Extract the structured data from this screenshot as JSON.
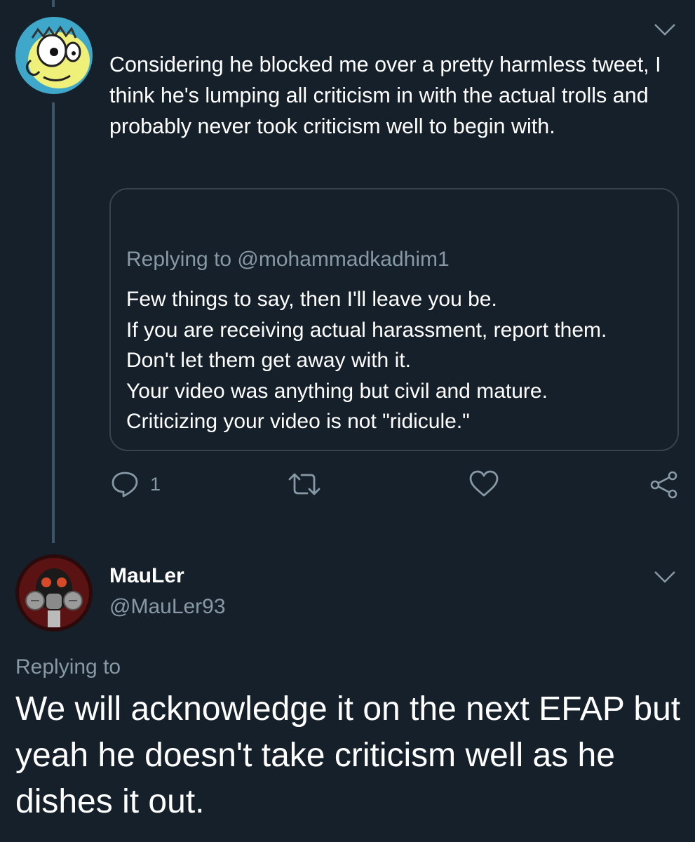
{
  "tweet1": {
    "text": "Considering he blocked me over a pretty harmless tweet, I think he's lumping all criticism in with the actual trolls and probably never took criticism well to begin with.",
    "avatar_icon": "cartoon-face-avatar",
    "menu_icon": "chevron-down-icon",
    "quote": {
      "replying_to": "Replying to @mohammadkadhim1",
      "lines": [
        "Few things to say, then I'll leave you be.",
        "If you are receiving actual harassment, report them.",
        "Don't let them get away with it.",
        "Your video was anything but civil and mature.",
        "Criticizing your video is not \"ridicule.\""
      ]
    },
    "actions": {
      "reply_icon": "reply-icon",
      "reply_count": "1",
      "retweet_icon": "retweet-icon",
      "like_icon": "heart-icon",
      "share_icon": "share-icon"
    }
  },
  "tweet2": {
    "author_name": "MauLer",
    "author_handle": "@MauLer93",
    "avatar_icon": "gas-mask-avatar",
    "menu_icon": "chevron-down-icon",
    "replying_to": "Replying to",
    "text": "We will acknowledge it on the next EFAP but yeah he doesn't take criticism well as he dishes it out."
  },
  "colors": {
    "background": "#15202b",
    "text_primary": "#ffffff",
    "text_secondary": "#8899a6",
    "border": "#38444d",
    "thread_line": "#3d5466"
  }
}
